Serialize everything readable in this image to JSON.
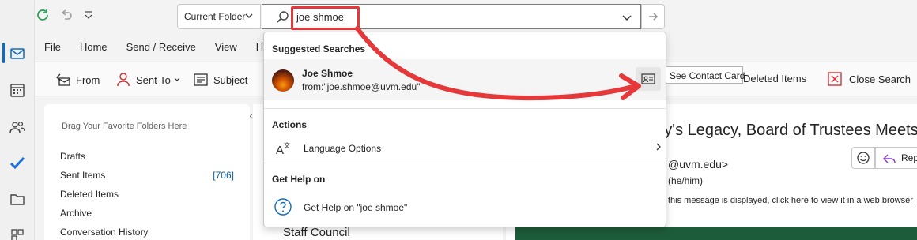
{
  "toolbar": {
    "scope_label": "Current Folder",
    "search_value": "joe shmoe"
  },
  "menu": {
    "items": [
      "File",
      "Home",
      "Send / Receive",
      "View",
      "H"
    ]
  },
  "ribbon": {
    "from_label": "From",
    "sent_to_label": "Sent To",
    "subject_label": "Subject",
    "deleted_items_label": "Deleted Items",
    "close_search_label": "Close Search"
  },
  "folders": {
    "hint": "Drag Your Favorite Folders Here",
    "items": [
      {
        "label": "Drafts",
        "count": ""
      },
      {
        "label": "Sent Items",
        "count": "[706]"
      },
      {
        "label": "Deleted Items",
        "count": ""
      },
      {
        "label": "Archive",
        "count": ""
      },
      {
        "label": "Conversation History",
        "count": ""
      }
    ]
  },
  "message_list": {
    "visible_item": "Staff Council"
  },
  "reading_pane": {
    "subject": "ahy's Legacy, Board of Trustees Meets",
    "from_fragment": "@uvm.edu>",
    "pronouns": "(he/him)",
    "notice": "this message is displayed, click here to view it in a web browser",
    "reply_label": "Rep"
  },
  "dropdown": {
    "suggested_header": "Suggested Searches",
    "contact_name": "Joe Shmoe",
    "contact_query": "from:\"joe.shmoe@uvm.edu\"",
    "actions_header": "Actions",
    "language_options": "Language Options",
    "help_header": "Get Help on",
    "help_item": "Get Help on \"joe shmoe\""
  },
  "tooltip": {
    "text": "See Contact Card"
  },
  "colors": {
    "accent": "#0f6cbd",
    "highlight": "#e5383b",
    "close_search_red": "#d13438",
    "brand_green": "#1d5c3a"
  }
}
